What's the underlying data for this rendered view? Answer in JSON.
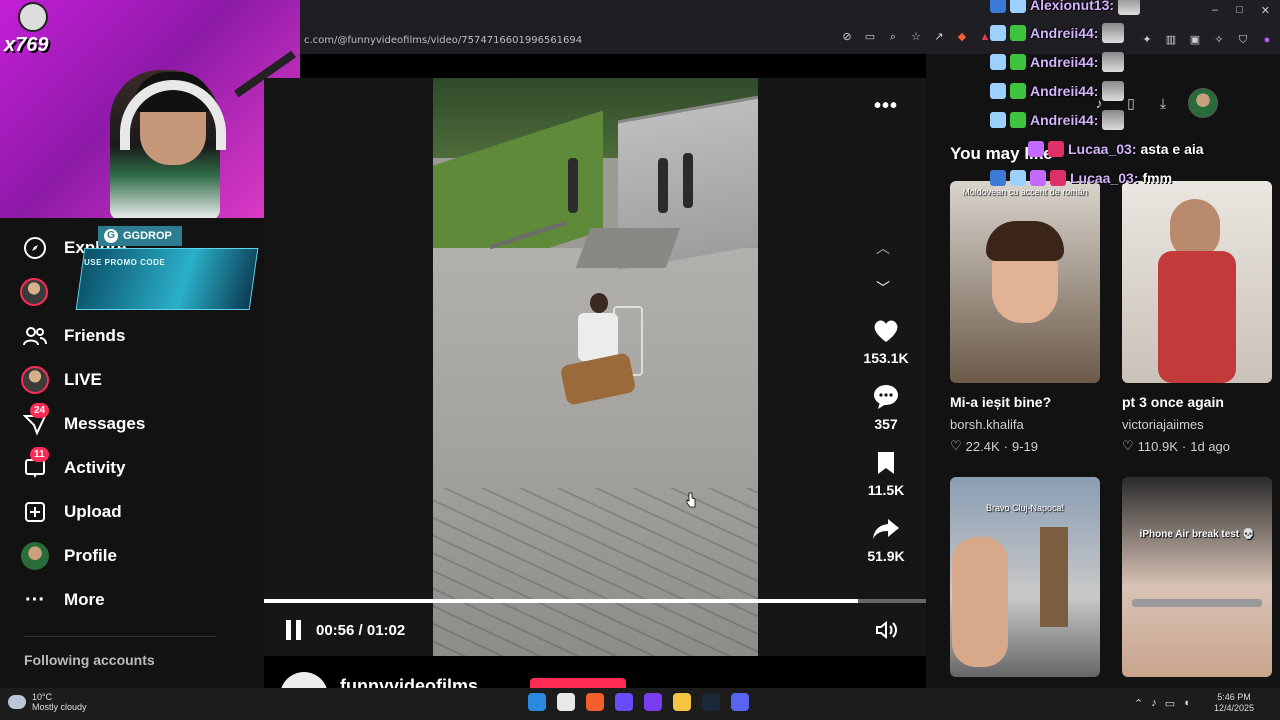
{
  "browser": {
    "url": "c.com/@funnyvideofilms/video/7574716601996561694",
    "window_controls": [
      "–",
      "□",
      "✕"
    ]
  },
  "stream": {
    "viewer_count": "x769",
    "ggdrop_label": "GGDROP",
    "ggdrop_text": "USE PROMO CODE"
  },
  "sidebar": {
    "items": [
      {
        "label": "Explore",
        "icon": "compass-icon"
      },
      {
        "label": "Friends",
        "icon": "friends-icon"
      },
      {
        "label": "LIVE",
        "icon": "live-avatar"
      },
      {
        "label": "Messages",
        "icon": "messages-icon",
        "badge": "24"
      },
      {
        "label": "Activity",
        "icon": "activity-icon",
        "badge": "11"
      },
      {
        "label": "Upload",
        "icon": "upload-icon"
      },
      {
        "label": "Profile",
        "icon": "profile-avatar"
      },
      {
        "label": "More",
        "icon": "more-icon"
      }
    ],
    "following_label": "Following accounts"
  },
  "player": {
    "time": "00:56 / 01:02",
    "progress": 0.897,
    "likes": "153.1K",
    "comments": "357",
    "saves": "11.5K",
    "shares": "51.9K",
    "author": "funnyvideofilms"
  },
  "recommendations": {
    "heading": "You may like",
    "items": [
      {
        "caption": "Moldovean cu accent de român",
        "title": "Mi-a ieșit bine?",
        "author": "borsh.khalifa",
        "likes": "22.4K",
        "date": "9-19",
        "color": "#6b5a4a"
      },
      {
        "caption": "",
        "title": "pt 3 once again",
        "author": "victoriajaiimes",
        "likes": "110.9K",
        "date": "1d ago",
        "color": "#c23a3a"
      },
      {
        "caption": "Bravo Cluj-Napoca!",
        "title": "",
        "author": "",
        "likes": "",
        "date": "",
        "color": "#8a9db3"
      },
      {
        "caption": "iPhone Air break test 💀",
        "title": "",
        "author": "",
        "likes": "",
        "date": "",
        "color": "#7a6a60"
      }
    ]
  },
  "chat": [
    {
      "user": "Alexionut13:",
      "message": "",
      "color": "#d4b3ff"
    },
    {
      "user": "Andreii44:",
      "message": "",
      "color": "#d4b3ff"
    },
    {
      "user": "Andreii44:",
      "message": "",
      "color": "#d4b3ff"
    },
    {
      "user": "Andreii44:",
      "message": "",
      "color": "#d4b3ff"
    },
    {
      "user": "Andreii44:",
      "message": "",
      "color": "#d4b3ff"
    },
    {
      "user": "Lucaa_03:",
      "message": "asta e aia",
      "color": "#d4b3ff"
    },
    {
      "user": "Lucaa_03:",
      "message": "fmm",
      "color": "#d4b3ff"
    }
  ],
  "taskbar": {
    "temperature": "10°C",
    "weather": "Mostly cloudy",
    "time": "5:46 PM",
    "date": "12/4/2025"
  },
  "colors": {
    "accent": "#fe2c55",
    "background": "#121212",
    "webcam_bg": "#c41fd6",
    "ggdrop": "#2c7d8f"
  }
}
